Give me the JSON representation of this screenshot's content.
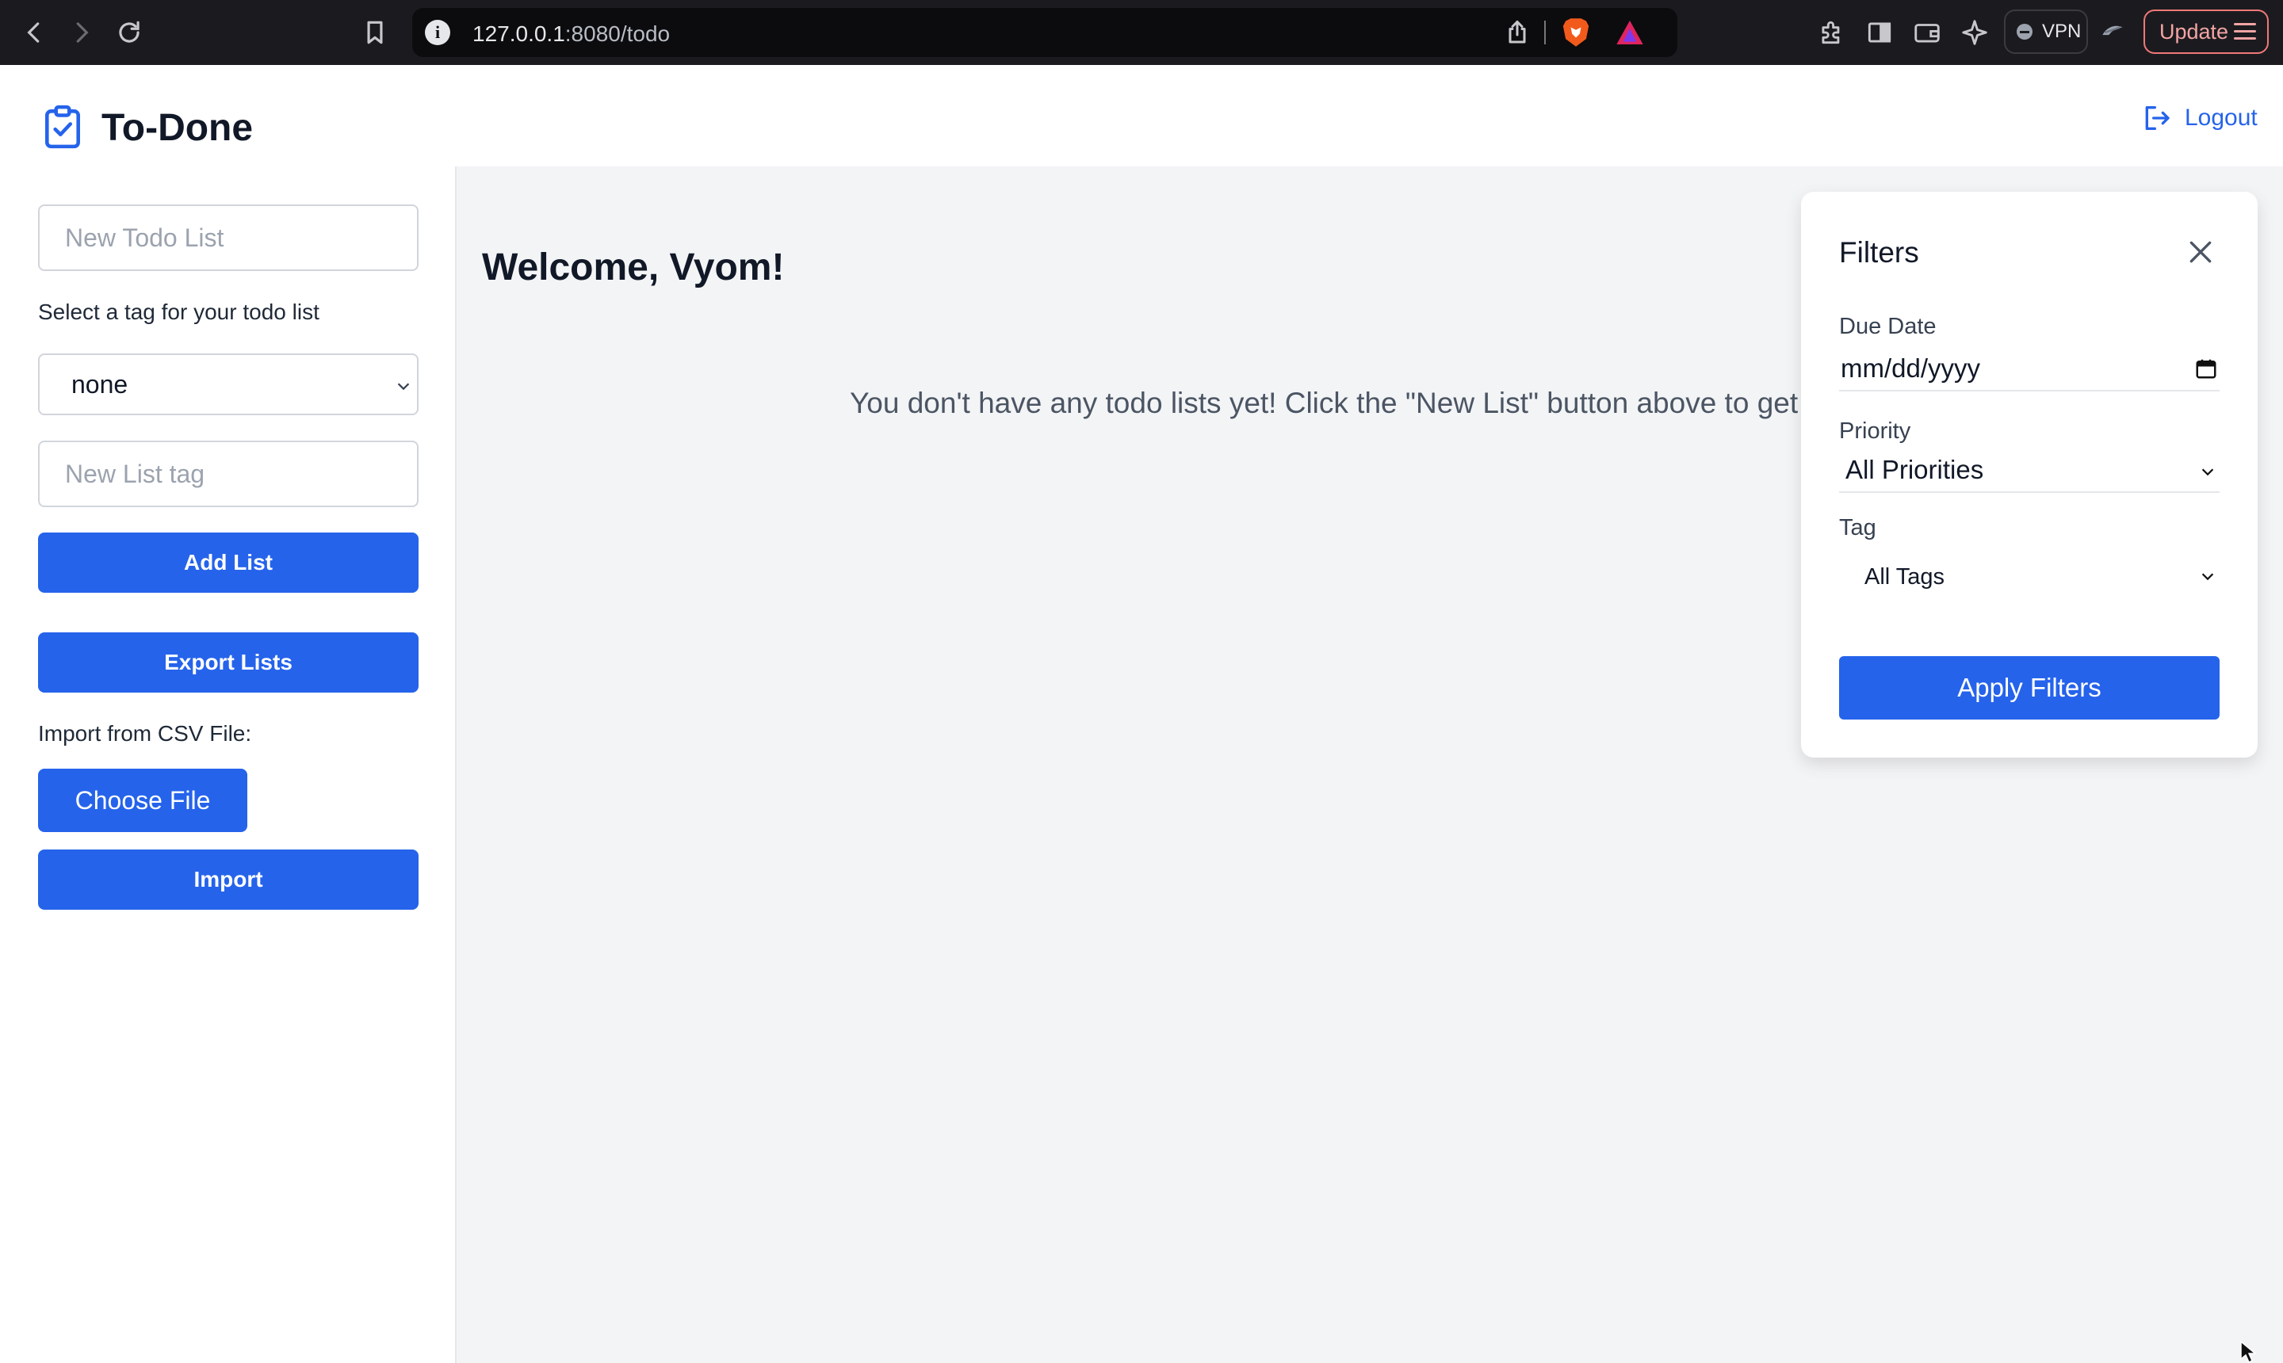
{
  "browser": {
    "url_host": "127.0.0.1",
    "url_path": ":8080/todo",
    "vpn_label": "VPN",
    "update_label": "Update"
  },
  "app": {
    "name": "To-Done",
    "logout_label": "Logout",
    "accent_color": "#2563eb"
  },
  "sidebar": {
    "new_list_placeholder": "New Todo List",
    "tag_prompt": "Select a tag for your todo list",
    "tag_selected": "none",
    "new_tag_placeholder": "New List tag",
    "add_list_label": "Add List",
    "export_label": "Export Lists",
    "import_prompt": "Import from CSV File:",
    "choose_file_label": "Choose File",
    "import_label": "Import"
  },
  "main": {
    "welcome": "Welcome, Vyom!",
    "empty_message": "You don't have any todo lists yet! Click the \"New List\" button above to get s"
  },
  "filters": {
    "title": "Filters",
    "due_date_label": "Due Date",
    "due_date_placeholder": "mm/dd/yyyy",
    "priority_label": "Priority",
    "priority_selected": "All Priorities",
    "tag_label": "Tag",
    "tag_selected": "All Tags",
    "apply_label": "Apply Filters"
  }
}
